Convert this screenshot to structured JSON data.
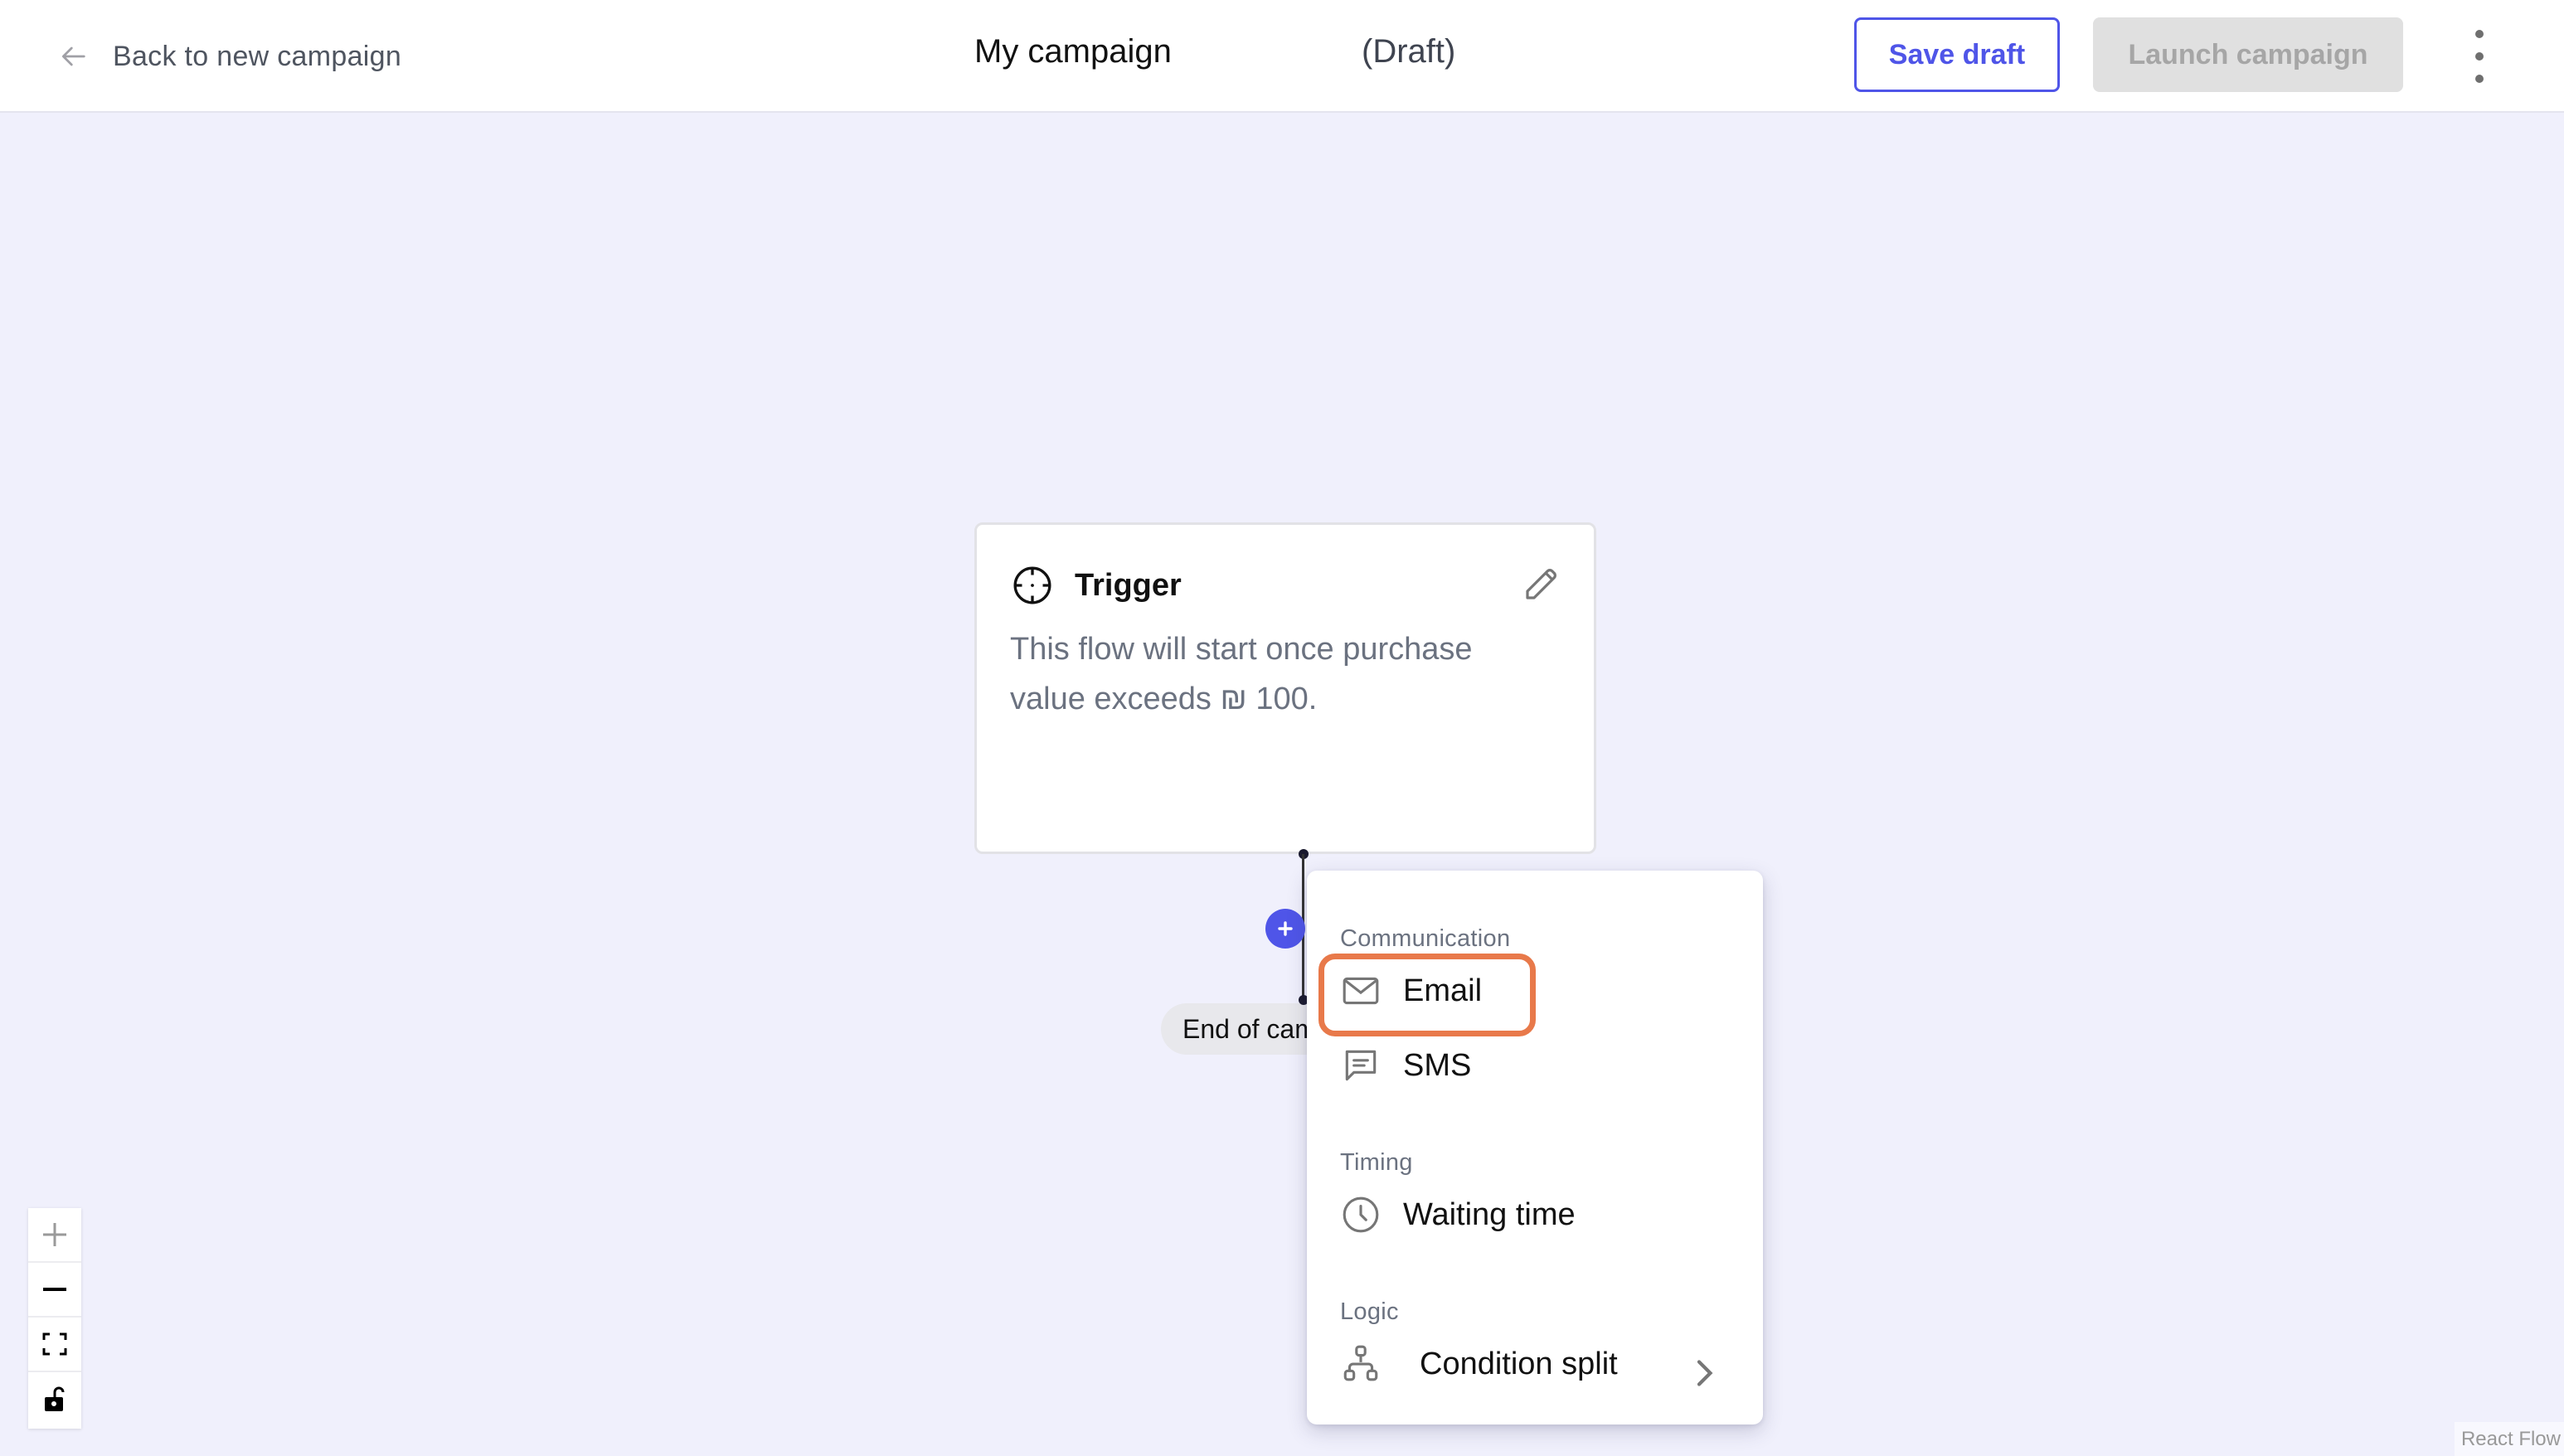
{
  "header": {
    "back_label": "Back to new campaign",
    "back_icon": "arrow-left-icon",
    "campaign_name": "My campaign",
    "campaign_status": "(Draft)",
    "save_draft_label": "Save draft",
    "launch_label": "Launch campaign",
    "launch_disabled": true,
    "more_icon": "kebab-menu-icon",
    "accent_color": "#4f55e8"
  },
  "canvas": {
    "trigger_node": {
      "icon": "crosshair-icon",
      "title": "Trigger",
      "description": "This flow will start once purchase value exceeds ₪ 100.",
      "edit_icon": "pencil-icon"
    },
    "add_step_icon": "plus-icon",
    "end_node_label": "End of campaign",
    "end_node_visible_text": "End of car"
  },
  "add_step_menu": {
    "sections": [
      {
        "label": "Communication",
        "items": [
          {
            "label": "Email",
            "icon": "mail-icon",
            "highlighted": true
          },
          {
            "label": "SMS",
            "icon": "chat-icon"
          }
        ]
      },
      {
        "label": "Timing",
        "items": [
          {
            "label": "Waiting time",
            "icon": "clock-icon"
          }
        ]
      },
      {
        "label": "Logic",
        "items": [
          {
            "label": "Condition split",
            "icon": "hierarchy-icon",
            "has_submenu": true
          }
        ]
      }
    ],
    "highlight_color": "#e8794a"
  },
  "flow_controls": [
    {
      "name": "zoom-in",
      "icon": "plus-icon"
    },
    {
      "name": "zoom-out",
      "icon": "minus-icon"
    },
    {
      "name": "fit-view",
      "icon": "fit-view-icon"
    },
    {
      "name": "toggle-interactivity",
      "icon": "unlock-icon"
    }
  ],
  "attribution": "React Flow"
}
